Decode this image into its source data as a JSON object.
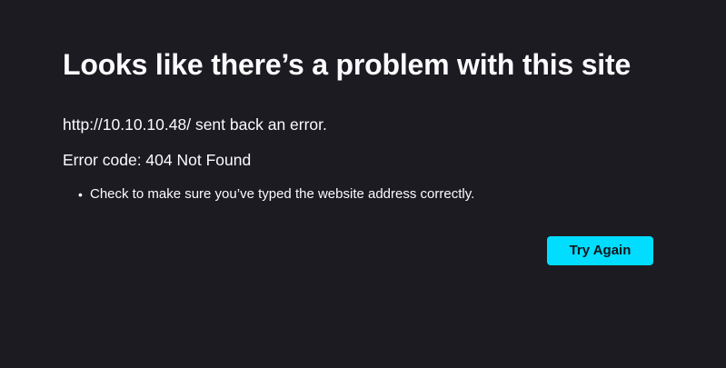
{
  "error_page": {
    "title": "Looks like there’s a problem with this site",
    "url_message": "http://10.10.10.48/ sent back an error.",
    "error_code": "Error code: 404 Not Found",
    "suggestions": [
      "Check to make sure you’ve typed the website address correctly."
    ],
    "try_again_label": "Try Again"
  },
  "colors": {
    "background": "#1c1b22",
    "text": "#fbfbfe",
    "button_background": "#00ddff",
    "button_text": "#15141a"
  }
}
